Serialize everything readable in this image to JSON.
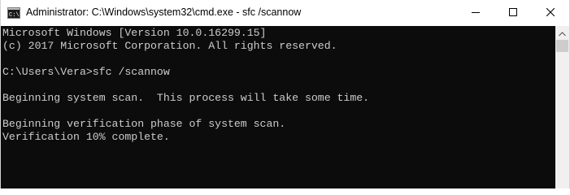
{
  "window": {
    "title": "Administrator: C:\\Windows\\system32\\cmd.exe - sfc  /scannow",
    "app_icon": "cmd-icon",
    "buttons": {
      "minimize": "minimize-icon",
      "maximize": "maximize-icon",
      "close": "close-icon"
    }
  },
  "console": {
    "lines": [
      "Microsoft Windows [Version 10.0.16299.15]",
      "(c) 2017 Microsoft Corporation. All rights reserved.",
      "",
      "C:\\Users\\Vera>sfc /scannow",
      "",
      "Beginning system scan.  This process will take some time.",
      "",
      "Beginning verification phase of system scan.",
      "Verification 10% complete."
    ],
    "colors": {
      "background": "#0c0c0c",
      "text": "#cccccc"
    }
  }
}
